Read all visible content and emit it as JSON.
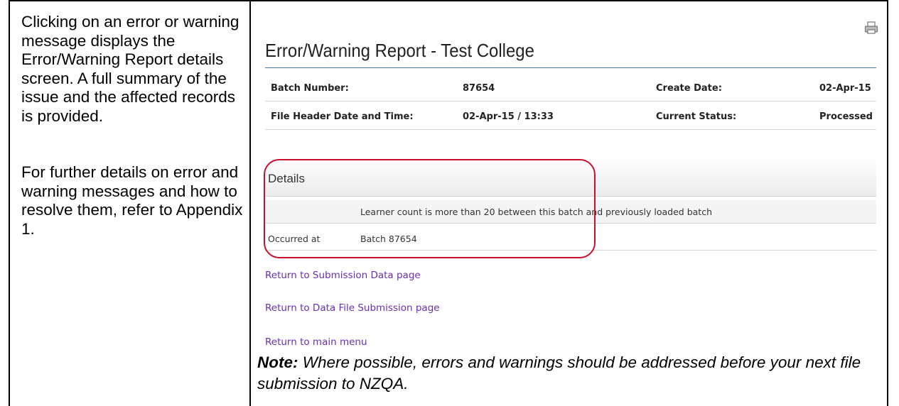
{
  "left_panel": {
    "paragraph1": "Clicking on an error or warning message displays the Error/Warning Report details screen. A full summary of the issue and the affected records is provided.",
    "paragraph2": "For further details on error and warning messages and how to resolve them, refer to Appendix 1."
  },
  "report": {
    "title": "Error/Warning Report - Test College",
    "print_icon": "printer-icon",
    "meta": {
      "batch_number_label": "Batch Number:",
      "batch_number_value": "87654",
      "create_date_label": "Create Date:",
      "create_date_value": "02-Apr-15",
      "file_header_label": "File Header Date and Time:",
      "file_header_value": "02-Apr-15 / 13:33",
      "current_status_label": "Current Status:",
      "current_status_value": "Processed"
    },
    "details": {
      "heading": "Details",
      "message": "Learner count is more than 20 between this batch and previously loaded batch",
      "occurred_label": "Occurred at",
      "occurred_value": "Batch  87654"
    },
    "links": {
      "submission_data": "Return to Submission Data page",
      "data_file_submission": "Return to Data File Submission page",
      "main_menu": "Return to main menu"
    },
    "highlight_color": "#c8102e",
    "link_color": "#6a2fb0"
  },
  "note": {
    "label": "Note:",
    "text": " Where possible, errors and warnings should be addressed before your next file submission to NZQA."
  }
}
